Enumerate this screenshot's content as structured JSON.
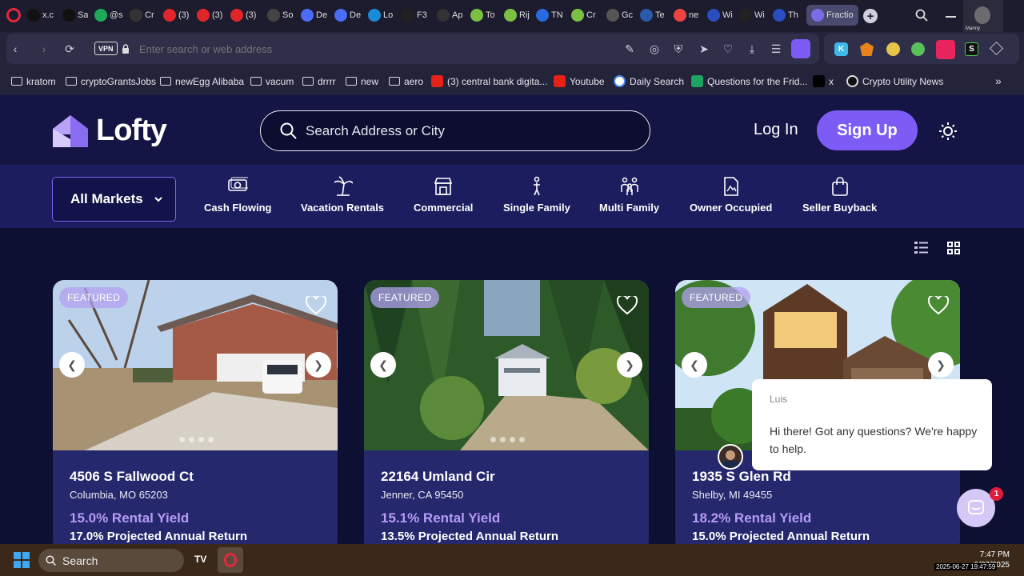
{
  "browser": {
    "tabs": [
      {
        "label": "x.c",
        "color": "#111"
      },
      {
        "label": "Sa",
        "color": "#111"
      },
      {
        "label": "@s",
        "color": "#1faa59"
      },
      {
        "label": "Cr",
        "color": "#333"
      },
      {
        "label": "(3)",
        "color": "#e0262b"
      },
      {
        "label": "(3)",
        "color": "#e0262b"
      },
      {
        "label": "(3)",
        "color": "#e0262b"
      },
      {
        "label": "So",
        "color": "#444"
      },
      {
        "label": "De",
        "color": "#4a6cf7"
      },
      {
        "label": "De",
        "color": "#4a6cf7"
      },
      {
        "label": "Lo",
        "color": "#1a8bd6"
      },
      {
        "label": "F3",
        "color": "#222"
      },
      {
        "label": "Ap",
        "color": "#333"
      },
      {
        "label": "To",
        "color": "#7bc043"
      },
      {
        "label": "Rij",
        "color": "#7bc043"
      },
      {
        "label": "TN",
        "color": "#2a6ae0"
      },
      {
        "label": "Cr",
        "color": "#7bc043"
      },
      {
        "label": "Gc",
        "color": "#555"
      },
      {
        "label": "Te",
        "color": "#2a5aa8"
      },
      {
        "label": "ne",
        "color": "#e44"
      },
      {
        "label": "Wi",
        "color": "#2a4ec0"
      },
      {
        "label": "Wi",
        "color": "#222"
      },
      {
        "label": "Th",
        "color": "#2a4ec0"
      },
      {
        "label": "Fractio",
        "color": "#7b6ce8"
      }
    ],
    "address_placeholder": "Enter search or web address",
    "vpn_label": "VPN",
    "bookmarks": [
      {
        "label": "kratom",
        "icon": "folder-icon"
      },
      {
        "label": "cryptoGrantsJobs",
        "icon": "folder-icon"
      },
      {
        "label": "newEgg Alibaba",
        "icon": "folder-icon"
      },
      {
        "label": "vacum",
        "icon": "folder-icon"
      },
      {
        "label": "drrrr",
        "icon": "folder-icon"
      },
      {
        "label": "new",
        "icon": "folder-icon"
      },
      {
        "label": "aero",
        "icon": "folder-icon"
      },
      {
        "label": "(3) central bank digita...",
        "icon": "youtube-icon"
      },
      {
        "label": "Youtube",
        "icon": "youtube-icon"
      },
      {
        "label": "Daily Search",
        "icon": "google-icon"
      },
      {
        "label": "Questions for the Frid...",
        "icon": "sheets-icon"
      },
      {
        "label": "x",
        "icon": "x-icon"
      },
      {
        "label": "Crypto Utility News",
        "icon": "circle-icon"
      }
    ],
    "profile_label": "Manny"
  },
  "site": {
    "logo": "Lofty",
    "search_placeholder": "Search Address or City",
    "login": "Log In",
    "signup": "Sign Up",
    "markets": "All Markets",
    "categories": [
      {
        "label": "Cash Flowing",
        "icon": "cash-icon"
      },
      {
        "label": "Vacation Rentals",
        "icon": "palm-tree-icon"
      },
      {
        "label": "Commercial",
        "icon": "storefront-icon"
      },
      {
        "label": "Single Family",
        "icon": "person-icon"
      },
      {
        "label": "Multi Family",
        "icon": "family-icon"
      },
      {
        "label": "Owner Occupied",
        "icon": "document-icon"
      },
      {
        "label": "Seller Buyback",
        "icon": "bag-icon"
      }
    ]
  },
  "listings": [
    {
      "badge": "FEATURED",
      "address": "4506 S Fallwood Ct",
      "city": "Columbia, MO 65203",
      "yield": "15.0% Rental Yield",
      "projected": "17.0% Projected Annual Return"
    },
    {
      "badge": "FEATURED",
      "address": "22164 Umland Cir",
      "city": "Jenner, CA 95450",
      "yield": "15.1% Rental Yield",
      "projected": "13.5% Projected Annual Return"
    },
    {
      "badge": "FEATURED",
      "address": "1935 S Glen Rd",
      "city": "Shelby, MI 49455",
      "yield": "18.2% Rental Yield",
      "projected": "15.0% Projected Annual Return"
    }
  ],
  "chat": {
    "agent": "Luis",
    "message": "Hi there! Got any questions? We're happy to help.",
    "badge": "1"
  },
  "taskbar": {
    "search": "Search",
    "time": "7:47 PM",
    "date": "6/27/2025",
    "stamp": "2025-06-27 19:47:59"
  }
}
